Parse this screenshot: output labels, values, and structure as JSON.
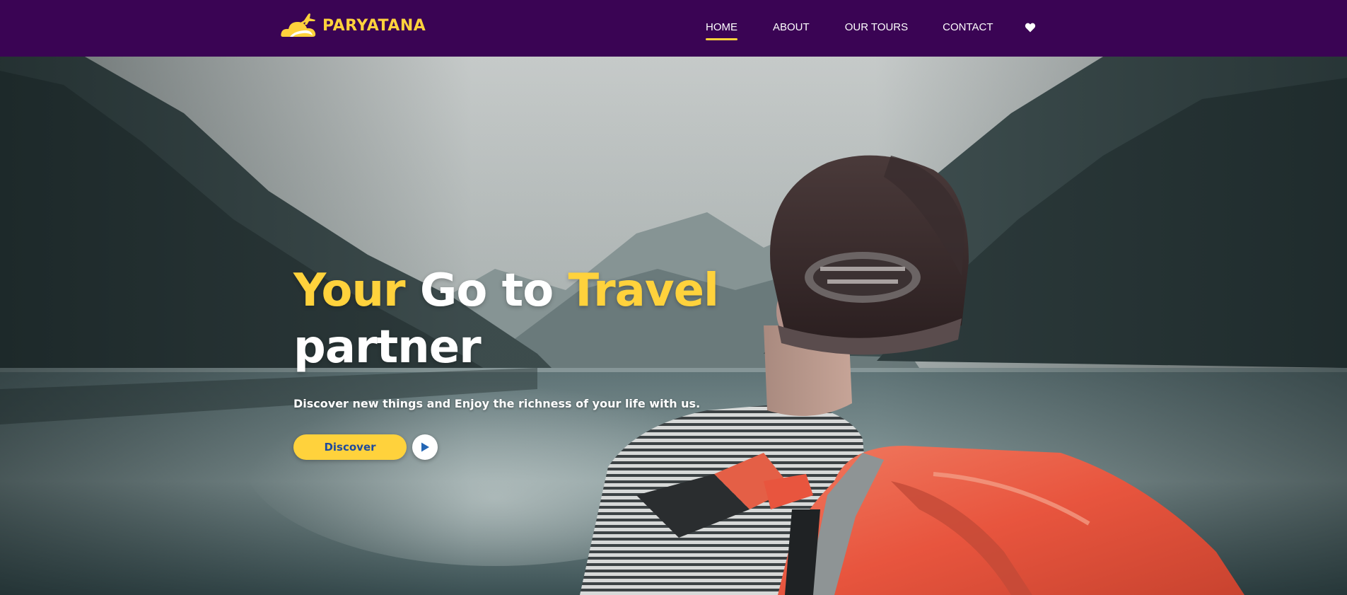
{
  "brand": {
    "name": "PARYATANA",
    "logo_icon": "cloud-airplane-icon"
  },
  "nav": {
    "items": [
      {
        "label": "HOME",
        "active": true
      },
      {
        "label": "ABOUT",
        "active": false
      },
      {
        "label": "OUR TOURS",
        "active": false
      },
      {
        "label": "CONTACT",
        "active": false
      }
    ],
    "wishlist_icon": "heart-icon"
  },
  "hero": {
    "title_words": [
      "Your",
      "Go",
      "to",
      "Travel",
      "partner"
    ],
    "subtitle": "Discover new things and Enjoy the richness of your life with us.",
    "cta_label": "Discover",
    "play_icon": "play-icon",
    "background": "photo of backpacker with orange backpack looking at mountain lake"
  },
  "colors": {
    "navbar_bg": "#3a0454",
    "accent_yellow": "#ffd23c",
    "text_white": "#ffffff",
    "button_text_blue": "#1f4b9c"
  }
}
